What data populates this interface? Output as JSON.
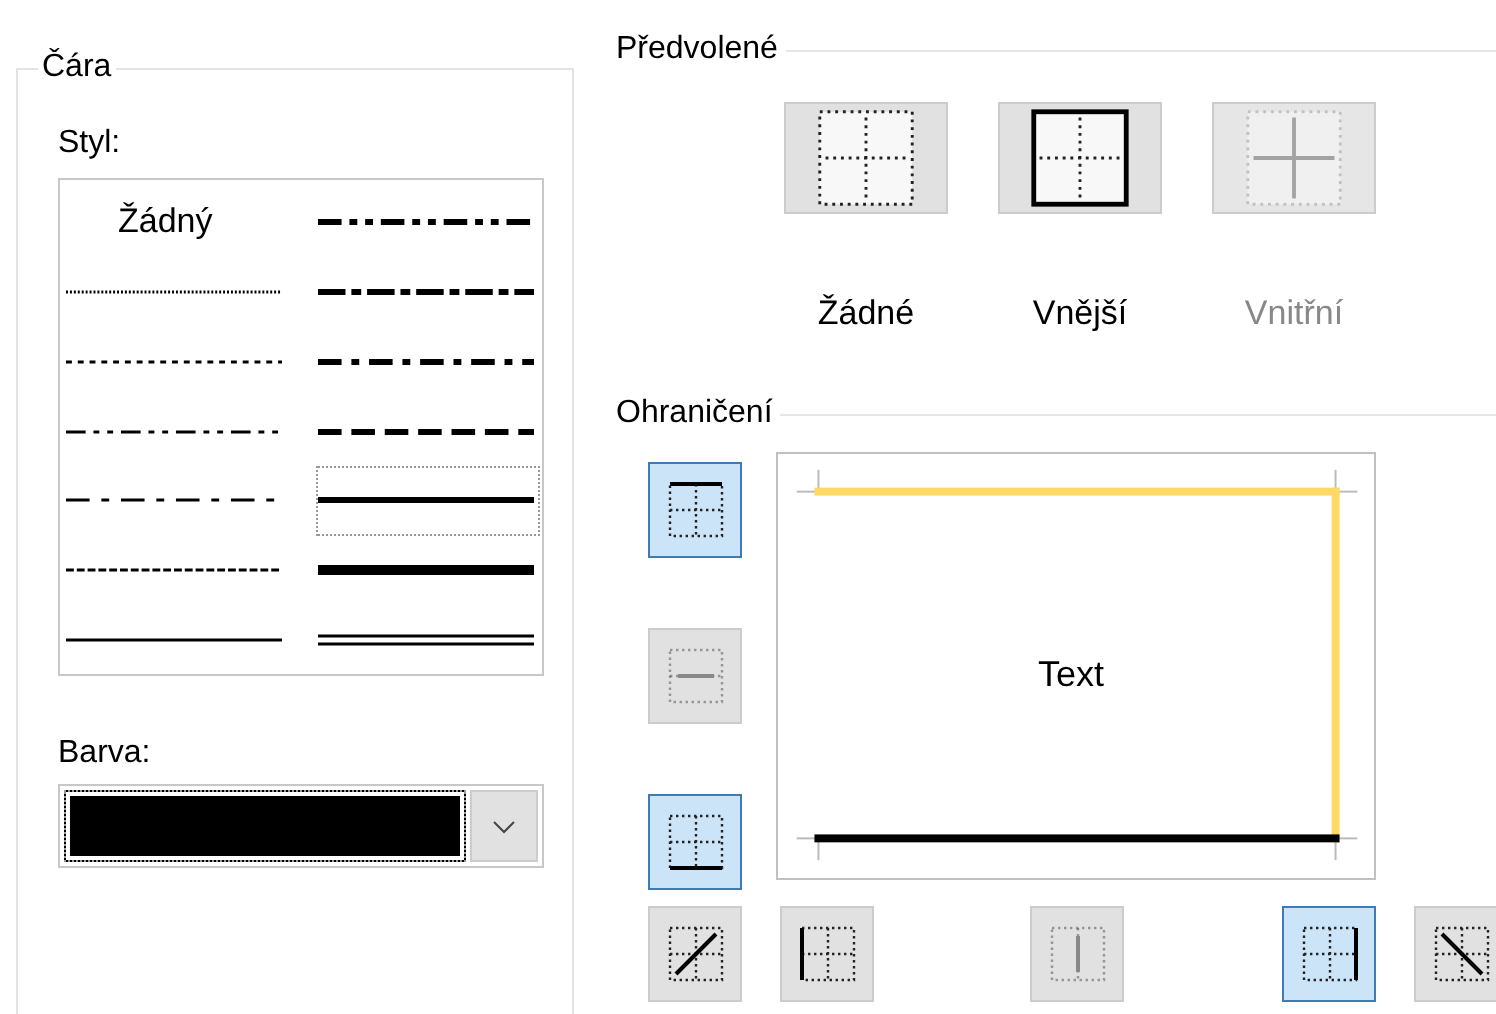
{
  "line_group": {
    "title": "Čára",
    "style_label": "Styl:",
    "styles": [
      {
        "kind": "none",
        "label": "Žádný",
        "selected": false
      },
      {
        "kind": "hair",
        "selected": false
      },
      {
        "kind": "dotted",
        "selected": false
      },
      {
        "kind": "dash-dot-dot",
        "selected": false
      },
      {
        "kind": "dash-dot",
        "selected": false
      },
      {
        "kind": "dashed",
        "selected": false
      },
      {
        "kind": "thin",
        "selected": false
      },
      {
        "kind": "medium-dash-dot-dot",
        "selected": false
      },
      {
        "kind": "slant-dash-dot",
        "selected": false
      },
      {
        "kind": "medium-dash-dot",
        "selected": false
      },
      {
        "kind": "medium-dashed",
        "selected": false
      },
      {
        "kind": "medium",
        "selected": true
      },
      {
        "kind": "thick",
        "selected": false
      },
      {
        "kind": "double",
        "selected": false
      }
    ],
    "color_label": "Barva:",
    "color": "#000000"
  },
  "presets": {
    "title": "Předvolené",
    "items": [
      {
        "kind": "none",
        "label": "Žádné",
        "disabled": false
      },
      {
        "kind": "outline",
        "label": "Vnější",
        "disabled": false
      },
      {
        "kind": "inside",
        "label": "Vnitřní",
        "disabled": true
      }
    ]
  },
  "border": {
    "title": "Ohraničení",
    "preview_text": "Text",
    "edges": [
      {
        "kind": "top",
        "color": "#ffd966"
      },
      {
        "kind": "right",
        "color": "#ffd966"
      },
      {
        "kind": "bottom",
        "color": "#000000"
      }
    ],
    "buttons": [
      {
        "kind": "top",
        "selected": true,
        "disabled": false
      },
      {
        "kind": "inside-horizontal",
        "selected": false,
        "disabled": true
      },
      {
        "kind": "bottom",
        "selected": true,
        "disabled": false
      },
      {
        "kind": "diagonal-up",
        "selected": false,
        "disabled": false
      },
      {
        "kind": "left",
        "selected": false,
        "disabled": false
      },
      {
        "kind": "inside-vertical",
        "selected": false,
        "disabled": true
      },
      {
        "kind": "right",
        "selected": true,
        "disabled": false
      },
      {
        "kind": "diagonal-down",
        "selected": false,
        "disabled": false
      }
    ]
  }
}
